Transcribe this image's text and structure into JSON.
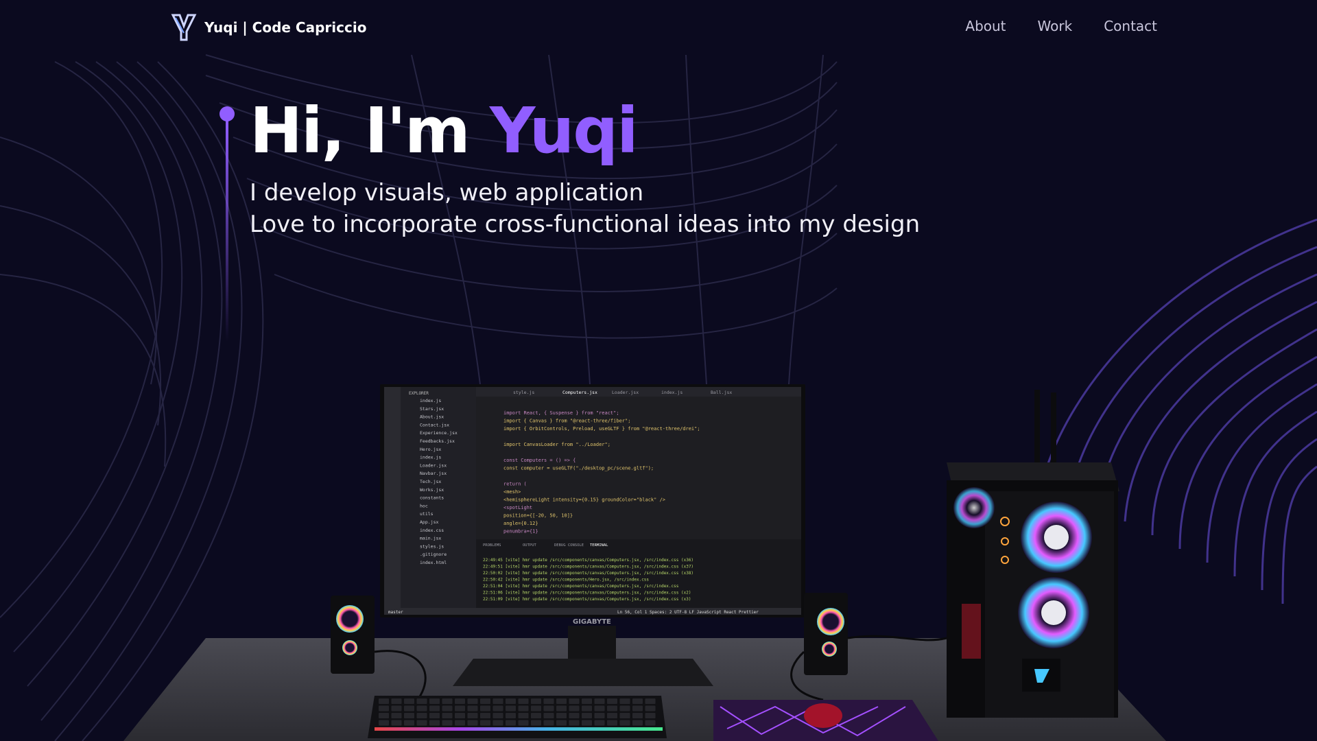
{
  "nav": {
    "brand": "Yuqi | Code Capriccio",
    "links": [
      "About",
      "Work",
      "Contact"
    ]
  },
  "hero": {
    "greeting": "Hi, I'm ",
    "name": "Yuqi",
    "line1": "I develop visuals, web application",
    "line2": "Love to incorporate cross-functional ideas into my design"
  },
  "scene": {
    "monitor_brand": "GIGABYTE",
    "editor_tabs": [
      "style.js",
      "Computers.jsx",
      "Loader.jsx",
      "index.js",
      "Ball.jsx"
    ],
    "explorer_title": "EXPLORER",
    "explorer_files": [
      "index.js",
      "Stars.jsx",
      "About.jsx",
      "Contact.jsx",
      "Experience.jsx",
      "Feedbacks.jsx",
      "Hero.jsx",
      "index.js",
      "Loader.jsx",
      "Navbar.jsx",
      "Tech.jsx",
      "Works.jsx",
      "constants",
      "hoc",
      "utils",
      "App.jsx",
      "index.css",
      "main.jsx",
      "styles.js",
      ".gitignore",
      "index.html"
    ],
    "code_lines": [
      "import React, { Suspense } from \"react\";",
      "import { Canvas } from \"@react-three/fiber\";",
      "import { OrbitControls, Preload, useGLTF } from \"@react-three/drei\";",
      "",
      "import CanvasLoader from \"../Loader\";",
      "",
      "const Computers = () => {",
      "  const computer = useGLTF(\"./desktop_pc/scene.gltf\");",
      "",
      "  return (",
      "    <mesh>",
      "      <hemisphereLight intensity={0.15} groundColor=\"black\" />",
      "      <spotLight",
      "        position={[-20, 50, 10]}",
      "        angle={0.12}",
      "        penumbra={1}"
    ],
    "panel_tabs": [
      "PROBLEMS",
      "OUTPUT",
      "DEBUG CONSOLE",
      "TERMINAL"
    ],
    "terminal_lines": [
      "22:49:45 [vite] hmr update /src/components/canvas/Computers.jsx, /src/index.css (x36)",
      "22:49:51 [vite] hmr update /src/components/canvas/Computers.jsx, /src/index.css (x37)",
      "22:50:02 [vite] hmr update /src/components/canvas/Computers.jsx, /src/index.css (x38)",
      "22:50:42 [vite] hmr update /src/components/Hero.jsx, /src/index.css",
      "22:51:04 [vite] hmr update /src/components/canvas/Computers.jsx, /src/index.css",
      "22:51:06 [vite] hmr update /src/components/canvas/Computers.jsx, /src/index.css (x2)",
      "22:51:09 [vite] hmr update /src/components/canvas/Computers.jsx, /src/index.css (x3)"
    ],
    "status_left": "master",
    "status_right": "Ln 56, Col 1   Spaces: 2   UTF-8   LF   JavaScript React   Prettier"
  },
  "colors": {
    "background": "#0b0a1f",
    "accent": "#915eff",
    "text": "#ffffff",
    "muted": "#c9c6dc"
  }
}
